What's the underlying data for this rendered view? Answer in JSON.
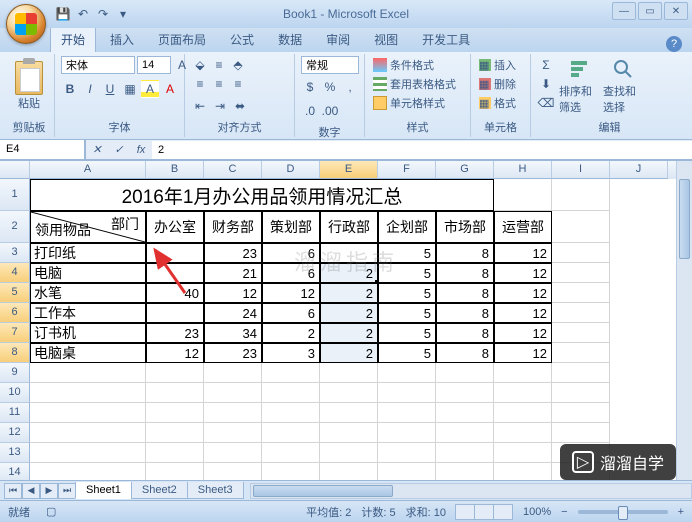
{
  "window": {
    "title": "Book1 - Microsoft Excel"
  },
  "qat": {
    "save": "💾",
    "undo": "↶",
    "redo": "↷"
  },
  "tabs": [
    "开始",
    "插入",
    "页面布局",
    "公式",
    "数据",
    "审阅",
    "视图",
    "开发工具"
  ],
  "active_tab": 0,
  "ribbon": {
    "clipboard": {
      "paste": "粘贴",
      "label": "剪贴板"
    },
    "font": {
      "name": "宋体",
      "size": "14",
      "label": "字体",
      "bold": "B",
      "italic": "I",
      "underline": "U"
    },
    "alignment": {
      "label": "对齐方式",
      "wrap": "常规"
    },
    "number": {
      "format": "常规",
      "label": "数字"
    },
    "styles": {
      "cond": "条件格式",
      "table": "套用表格格式",
      "cell": "单元格样式",
      "label": "样式"
    },
    "cells": {
      "insert": "插入",
      "delete": "删除",
      "format": "格式",
      "label": "单元格"
    },
    "editing": {
      "sort": "排序和筛选",
      "find": "查找和选择",
      "label": "编辑"
    }
  },
  "namebox": "E4",
  "formula": "2",
  "columns": [
    "A",
    "B",
    "C",
    "D",
    "E",
    "F",
    "G",
    "H",
    "I",
    "J"
  ],
  "row_numbers": [
    "1",
    "2",
    "3",
    "4",
    "5",
    "6",
    "7",
    "8",
    "9",
    "10",
    "11",
    "12",
    "13",
    "14"
  ],
  "sheet": {
    "title": "2016年1月办公用品领用情况汇总",
    "diag_top": "部门",
    "diag_bottom": "领用物品",
    "headers": [
      "办公室",
      "财务部",
      "策划部",
      "行政部",
      "企划部",
      "市场部",
      "运营部"
    ],
    "rows": [
      {
        "name": "打印纸",
        "vals": [
          "",
          "23",
          "6",
          "",
          "5",
          "8",
          "12"
        ]
      },
      {
        "name": "电脑",
        "vals": [
          "",
          "21",
          "6",
          "2",
          "5",
          "8",
          "12"
        ]
      },
      {
        "name": "水笔",
        "vals": [
          "40",
          "12",
          "12",
          "2",
          "5",
          "8",
          "12"
        ]
      },
      {
        "name": "工作本",
        "vals": [
          "",
          "24",
          "6",
          "2",
          "5",
          "8",
          "12"
        ]
      },
      {
        "name": "订书机",
        "vals": [
          "23",
          "34",
          "2",
          "2",
          "5",
          "8",
          "12"
        ]
      },
      {
        "name": "电脑桌",
        "vals": [
          "12",
          "23",
          "3",
          "2",
          "5",
          "8",
          "12"
        ]
      }
    ]
  },
  "sheets": [
    "Sheet1",
    "Sheet2",
    "Sheet3"
  ],
  "status": {
    "ready": "就绪",
    "avg_label": "平均值:",
    "avg": "2",
    "count_label": "计数:",
    "count": "5",
    "sum_label": "求和:",
    "sum": "10",
    "zoom": "100%"
  },
  "watermark_center": "溜溜指南",
  "watermark_logo": "溜溜自学"
}
